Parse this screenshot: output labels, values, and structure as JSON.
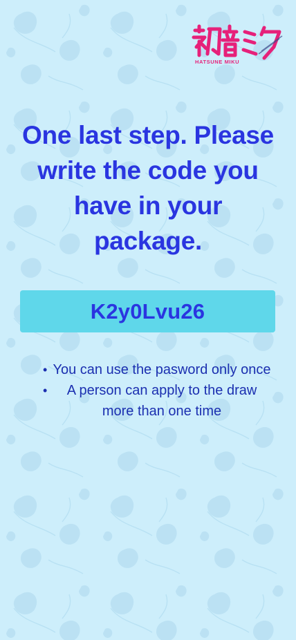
{
  "brand": {
    "logo_caption": "HATSUNE MIKU"
  },
  "prompt": {
    "title": "One last step. Please write the code you have in your package."
  },
  "code": {
    "value": "K2y0Lvu26"
  },
  "notes": {
    "items": [
      "You can use the pasword only once",
      "A person can apply to the draw more than one time"
    ]
  },
  "colors": {
    "background": "#cdeefb",
    "accent_text": "#2a35e0",
    "code_box": "#5fd7ea",
    "logo_pink": "#e6217a"
  }
}
